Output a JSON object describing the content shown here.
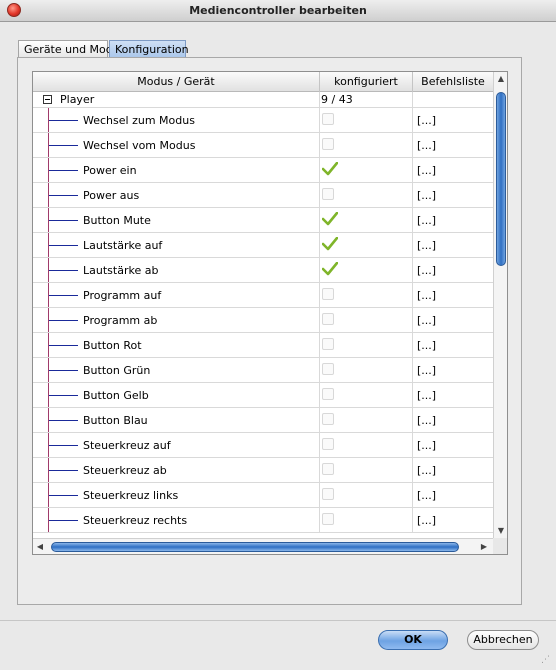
{
  "window": {
    "title": "Mediencontroller bearbeiten"
  },
  "tabs": [
    {
      "label": "Geräte und Modi",
      "active": false
    },
    {
      "label": "Konfiguration",
      "active": true
    }
  ],
  "table": {
    "columns": [
      "Modus / Gerät",
      "konfiguriert",
      "Befehlsliste"
    ],
    "parent": {
      "label": "Player",
      "configured": "9 / 43"
    },
    "rows": [
      {
        "label": "Wechsel zum Modus",
        "configured": false,
        "commands": "[...]"
      },
      {
        "label": "Wechsel vom Modus",
        "configured": false,
        "commands": "[...]"
      },
      {
        "label": "Power ein",
        "configured": true,
        "commands": "[...]"
      },
      {
        "label": "Power aus",
        "configured": false,
        "commands": "[...]"
      },
      {
        "label": "Button Mute",
        "configured": true,
        "commands": "[...]"
      },
      {
        "label": "Lautstärke auf",
        "configured": true,
        "commands": "[...]"
      },
      {
        "label": "Lautstärke ab",
        "configured": true,
        "commands": "[...]"
      },
      {
        "label": "Programm auf",
        "configured": false,
        "commands": "[...]"
      },
      {
        "label": "Programm ab",
        "configured": false,
        "commands": "[...]"
      },
      {
        "label": "Button Rot",
        "configured": false,
        "commands": "[...]"
      },
      {
        "label": "Button Grün",
        "configured": false,
        "commands": "[...]"
      },
      {
        "label": "Button Gelb",
        "configured": false,
        "commands": "[...]"
      },
      {
        "label": "Button Blau",
        "configured": false,
        "commands": "[...]"
      },
      {
        "label": "Steuerkreuz auf",
        "configured": false,
        "commands": "[...]"
      },
      {
        "label": "Steuerkreuz ab",
        "configured": false,
        "commands": "[...]"
      },
      {
        "label": "Steuerkreuz links",
        "configured": false,
        "commands": "[...]"
      },
      {
        "label": "Steuerkreuz rechts",
        "configured": false,
        "commands": "[...]"
      }
    ]
  },
  "buttons": {
    "ok": "OK",
    "cancel": "Abbrechen"
  },
  "colors": {
    "check": "#7fb52a",
    "accent": "#2f6fc3"
  }
}
